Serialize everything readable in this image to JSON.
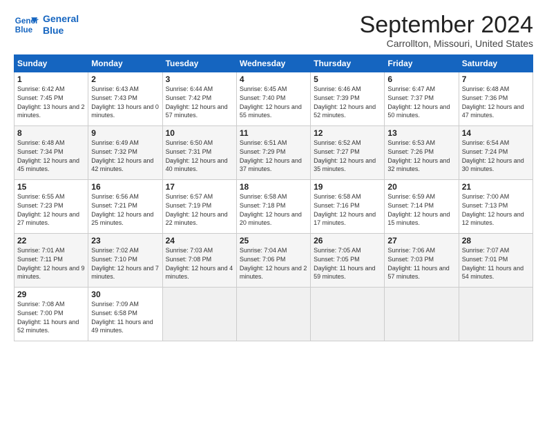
{
  "header": {
    "logo_line1": "General",
    "logo_line2": "Blue",
    "month": "September 2024",
    "location": "Carrollton, Missouri, United States"
  },
  "weekdays": [
    "Sunday",
    "Monday",
    "Tuesday",
    "Wednesday",
    "Thursday",
    "Friday",
    "Saturday"
  ],
  "weeks": [
    [
      {
        "day": "1",
        "sunrise": "6:42 AM",
        "sunset": "7:45 PM",
        "daylight": "13 hours and 2 minutes."
      },
      {
        "day": "2",
        "sunrise": "6:43 AM",
        "sunset": "7:43 PM",
        "daylight": "13 hours and 0 minutes."
      },
      {
        "day": "3",
        "sunrise": "6:44 AM",
        "sunset": "7:42 PM",
        "daylight": "12 hours and 57 minutes."
      },
      {
        "day": "4",
        "sunrise": "6:45 AM",
        "sunset": "7:40 PM",
        "daylight": "12 hours and 55 minutes."
      },
      {
        "day": "5",
        "sunrise": "6:46 AM",
        "sunset": "7:39 PM",
        "daylight": "12 hours and 52 minutes."
      },
      {
        "day": "6",
        "sunrise": "6:47 AM",
        "sunset": "7:37 PM",
        "daylight": "12 hours and 50 minutes."
      },
      {
        "day": "7",
        "sunrise": "6:48 AM",
        "sunset": "7:36 PM",
        "daylight": "12 hours and 47 minutes."
      }
    ],
    [
      {
        "day": "8",
        "sunrise": "6:48 AM",
        "sunset": "7:34 PM",
        "daylight": "12 hours and 45 minutes."
      },
      {
        "day": "9",
        "sunrise": "6:49 AM",
        "sunset": "7:32 PM",
        "daylight": "12 hours and 42 minutes."
      },
      {
        "day": "10",
        "sunrise": "6:50 AM",
        "sunset": "7:31 PM",
        "daylight": "12 hours and 40 minutes."
      },
      {
        "day": "11",
        "sunrise": "6:51 AM",
        "sunset": "7:29 PM",
        "daylight": "12 hours and 37 minutes."
      },
      {
        "day": "12",
        "sunrise": "6:52 AM",
        "sunset": "7:27 PM",
        "daylight": "12 hours and 35 minutes."
      },
      {
        "day": "13",
        "sunrise": "6:53 AM",
        "sunset": "7:26 PM",
        "daylight": "12 hours and 32 minutes."
      },
      {
        "day": "14",
        "sunrise": "6:54 AM",
        "sunset": "7:24 PM",
        "daylight": "12 hours and 30 minutes."
      }
    ],
    [
      {
        "day": "15",
        "sunrise": "6:55 AM",
        "sunset": "7:23 PM",
        "daylight": "12 hours and 27 minutes."
      },
      {
        "day": "16",
        "sunrise": "6:56 AM",
        "sunset": "7:21 PM",
        "daylight": "12 hours and 25 minutes."
      },
      {
        "day": "17",
        "sunrise": "6:57 AM",
        "sunset": "7:19 PM",
        "daylight": "12 hours and 22 minutes."
      },
      {
        "day": "18",
        "sunrise": "6:58 AM",
        "sunset": "7:18 PM",
        "daylight": "12 hours and 20 minutes."
      },
      {
        "day": "19",
        "sunrise": "6:58 AM",
        "sunset": "7:16 PM",
        "daylight": "12 hours and 17 minutes."
      },
      {
        "day": "20",
        "sunrise": "6:59 AM",
        "sunset": "7:14 PM",
        "daylight": "12 hours and 15 minutes."
      },
      {
        "day": "21",
        "sunrise": "7:00 AM",
        "sunset": "7:13 PM",
        "daylight": "12 hours and 12 minutes."
      }
    ],
    [
      {
        "day": "22",
        "sunrise": "7:01 AM",
        "sunset": "7:11 PM",
        "daylight": "12 hours and 9 minutes."
      },
      {
        "day": "23",
        "sunrise": "7:02 AM",
        "sunset": "7:10 PM",
        "daylight": "12 hours and 7 minutes."
      },
      {
        "day": "24",
        "sunrise": "7:03 AM",
        "sunset": "7:08 PM",
        "daylight": "12 hours and 4 minutes."
      },
      {
        "day": "25",
        "sunrise": "7:04 AM",
        "sunset": "7:06 PM",
        "daylight": "12 hours and 2 minutes."
      },
      {
        "day": "26",
        "sunrise": "7:05 AM",
        "sunset": "7:05 PM",
        "daylight": "11 hours and 59 minutes."
      },
      {
        "day": "27",
        "sunrise": "7:06 AM",
        "sunset": "7:03 PM",
        "daylight": "11 hours and 57 minutes."
      },
      {
        "day": "28",
        "sunrise": "7:07 AM",
        "sunset": "7:01 PM",
        "daylight": "11 hours and 54 minutes."
      }
    ],
    [
      {
        "day": "29",
        "sunrise": "7:08 AM",
        "sunset": "7:00 PM",
        "daylight": "11 hours and 52 minutes."
      },
      {
        "day": "30",
        "sunrise": "7:09 AM",
        "sunset": "6:58 PM",
        "daylight": "11 hours and 49 minutes."
      },
      null,
      null,
      null,
      null,
      null
    ]
  ]
}
